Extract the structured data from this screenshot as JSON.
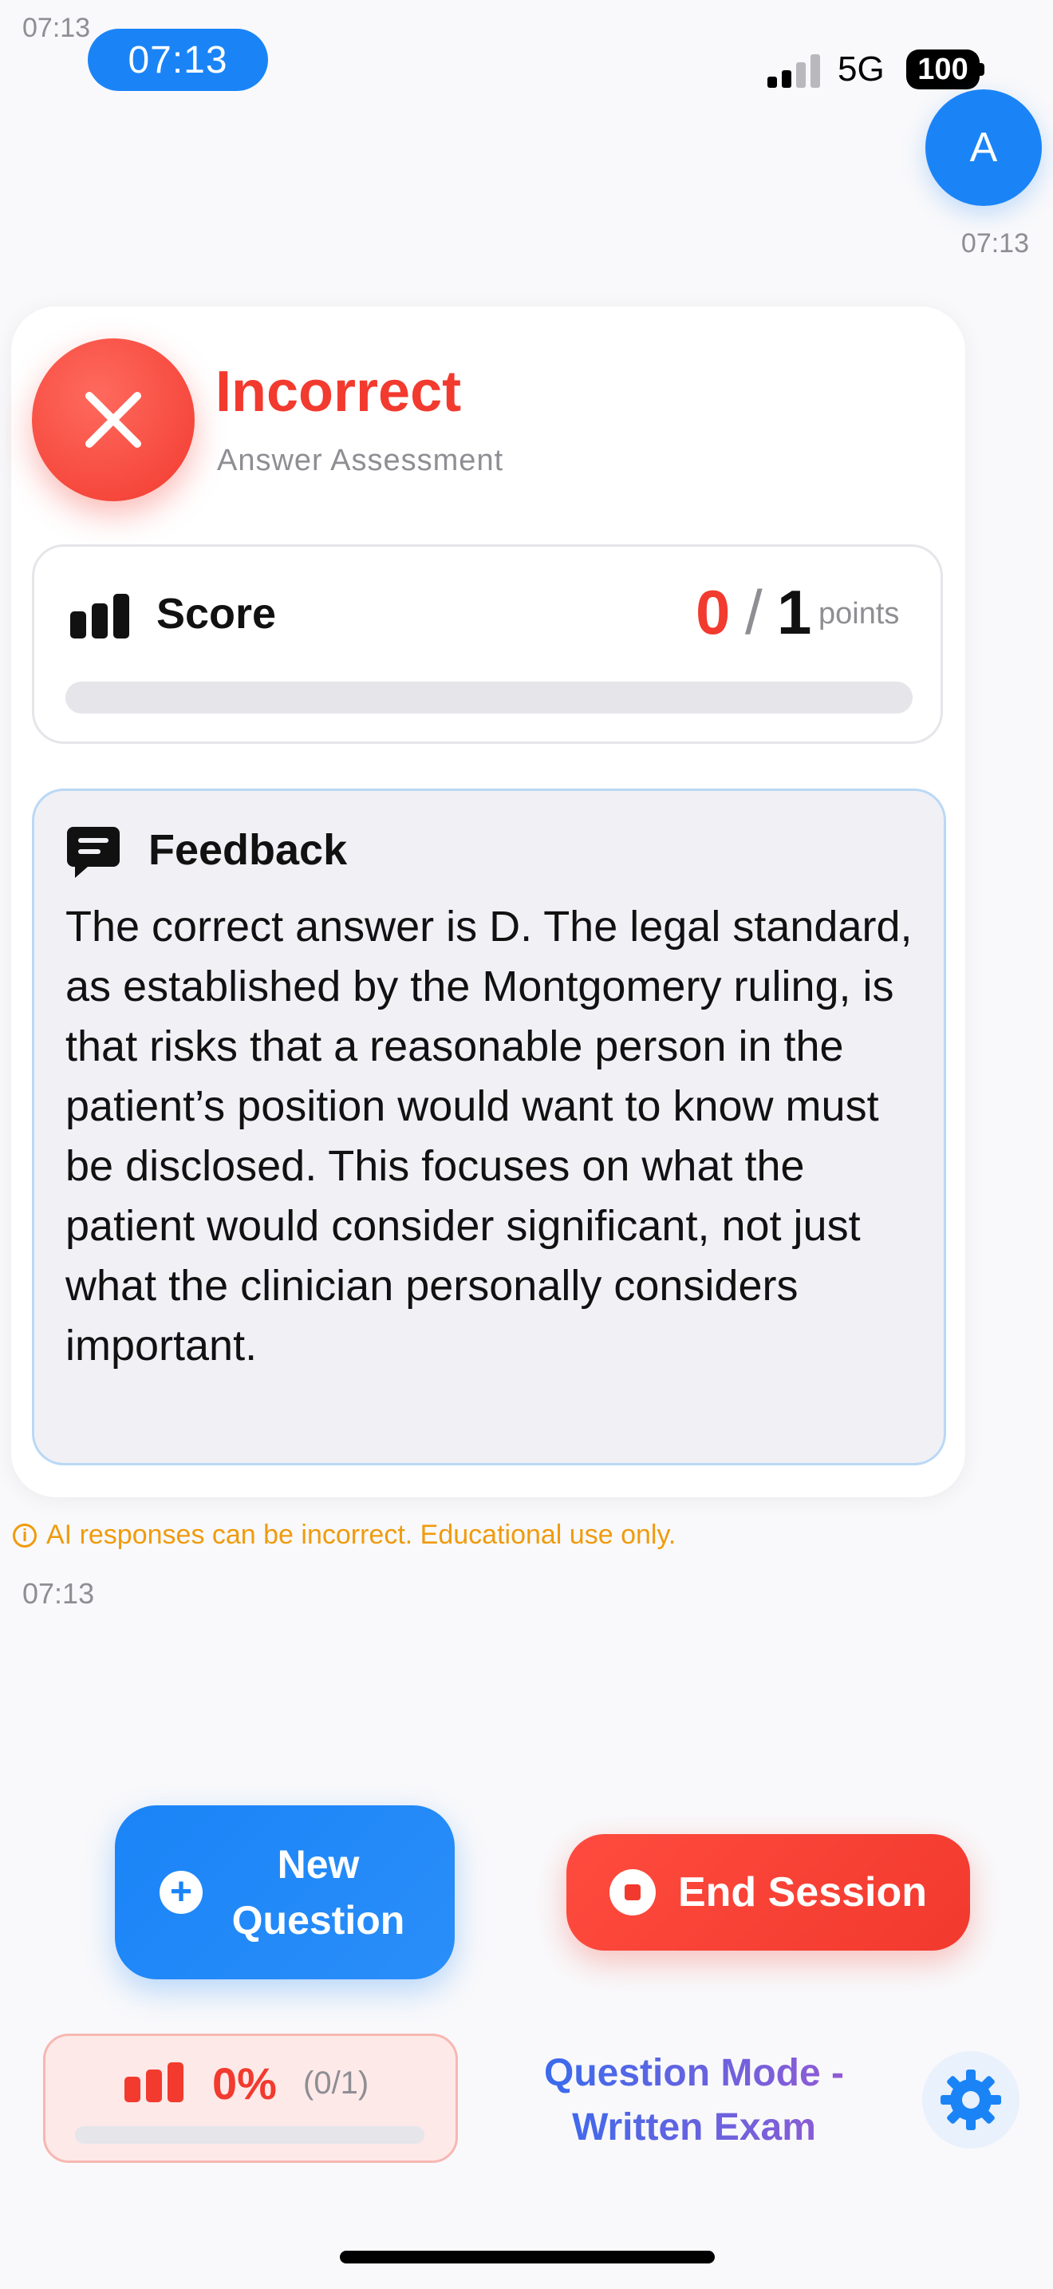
{
  "status_bar": {
    "tiny_time": "07:13",
    "time": "07:13",
    "network": "5G",
    "battery": "100"
  },
  "chat": {
    "user_avatar_initial": "A",
    "user_message_time": "07:13",
    "assistant_message_time": "07:13"
  },
  "result": {
    "title": "Incorrect",
    "subtitle": "Answer Assessment",
    "status_color": "#f23a2f",
    "icon": "close-icon"
  },
  "score": {
    "label": "Score",
    "earned": "0",
    "separator": "/",
    "total": "1",
    "unit": "points",
    "fraction": 0
  },
  "feedback": {
    "label": "Feedback",
    "text": "The correct answer is D. The legal standard, as established by the Montgomery ruling, is that risks that a reasonable person in the patient’s position would want to know must be disclosed. This focuses on what the patient would consider significant, not just what the clinician personally considers important."
  },
  "disclaimer": "AI responses can be incorrect. Educational use only.",
  "actions": {
    "new_question": "New Question",
    "end_session": "End Session"
  },
  "progress": {
    "percent": "0%",
    "count": "(0/1)",
    "fraction": 0
  },
  "mode": {
    "label": "Question Mode - Written Exam"
  },
  "colors": {
    "accent": "#1a84f7",
    "danger": "#f23a2f",
    "warning": "#ef9b0e"
  }
}
